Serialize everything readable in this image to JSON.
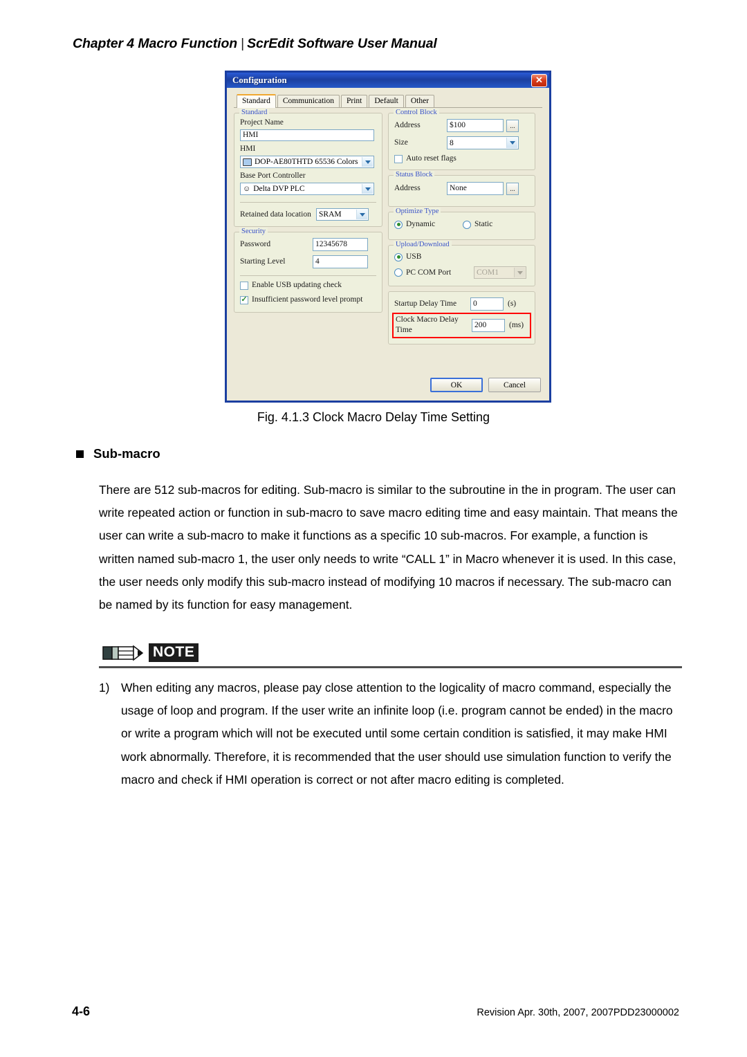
{
  "header": {
    "chapter": "Chapter 4  Macro Function",
    "separator": "|",
    "manual": "ScrEdit Software User Manual"
  },
  "dialog": {
    "title": "Configuration",
    "close_icon": "close-icon",
    "tabs": [
      {
        "label": "Standard",
        "active": true
      },
      {
        "label": "Communication",
        "active": false
      },
      {
        "label": "Print",
        "active": false
      },
      {
        "label": "Default",
        "active": false
      },
      {
        "label": "Other",
        "active": false
      }
    ],
    "standard_group": {
      "title": "Standard",
      "project_name_label": "Project Name",
      "project_name_value": "HMI",
      "hmi_label": "HMI",
      "hmi_value": "DOP-AE80THTD 65536 Colors",
      "base_port_label": "Base Port Controller",
      "base_port_value": "Delta DVP PLC",
      "retained_label": "Retained data location",
      "retained_value": "SRAM"
    },
    "security_group": {
      "title": "Security",
      "password_label": "Password",
      "password_value": "12345678",
      "starting_level_label": "Starting Level",
      "starting_level_value": "4",
      "enable_usb_label": "Enable USB updating check",
      "enable_usb_checked": false,
      "insufficient_label": "Insufficient password level prompt",
      "insufficient_checked": true
    },
    "control_block": {
      "title": "Control Block",
      "address_label": "Address",
      "address_value": "$100",
      "browse_label": "...",
      "size_label": "Size",
      "size_value": "8",
      "auto_reset_label": "Auto reset flags",
      "auto_reset_checked": false
    },
    "status_block": {
      "title": "Status Block",
      "address_label": "Address",
      "address_value": "None",
      "browse_label": "..."
    },
    "optimize_type": {
      "title": "Optimize Type",
      "dynamic_label": "Dynamic",
      "static_label": "Static",
      "selected": "Dynamic"
    },
    "upload_download": {
      "title": "Upload/Download",
      "usb_label": "USB",
      "pc_com_label": "PC COM Port",
      "com_port_value": "COM1",
      "selected": "USB"
    },
    "delay_group": {
      "startup_label": "Startup Delay Time",
      "startup_value": "0",
      "startup_unit": "(s)",
      "clock_macro_label": "Clock Macro Delay Time",
      "clock_macro_value": "200",
      "clock_macro_unit": "(ms)",
      "highlight_color": "#ff0000"
    },
    "buttons": {
      "ok": "OK",
      "cancel": "Cancel"
    }
  },
  "figure_caption": "Fig. 4.1.3 Clock Macro Delay Time Setting",
  "section": {
    "bullet": "square-bullet-icon",
    "heading": "Sub-macro",
    "paragraph": "There are 512 sub-macros for editing. Sub-macro is similar to the subroutine in the in program. The user can write repeated action or function in sub-macro to save macro editing time and easy maintain. That means the user can write a sub-macro to make it functions as a specific 10 sub-macros. For example, a function is written named sub-macro 1, the user only needs to write “CALL 1” in Macro whenever it is used.  In this case, the user needs only modify this sub-macro instead of modifying 10 macros if necessary. The sub-macro can be named by its function for easy management."
  },
  "note": {
    "badge_icon": "pencil-icon",
    "badge_label": "NOTE",
    "items": [
      {
        "number": "1)",
        "text": "When editing any macros, please pay close attention to the logicality of macro command, especially the usage of loop and program. If the user write an infinite loop (i.e. program cannot be ended) in the macro or write a program which will not be executed until some certain condition is satisfied, it may make HMI work abnormally. Therefore, it is recommended that the user should use simulation function to verify the macro and check if HMI operation is correct or not after macro editing is completed."
      }
    ]
  },
  "footer": {
    "page_number": "4-6",
    "revision": "Revision Apr. 30th, 2007, 2007PDD23000002"
  }
}
